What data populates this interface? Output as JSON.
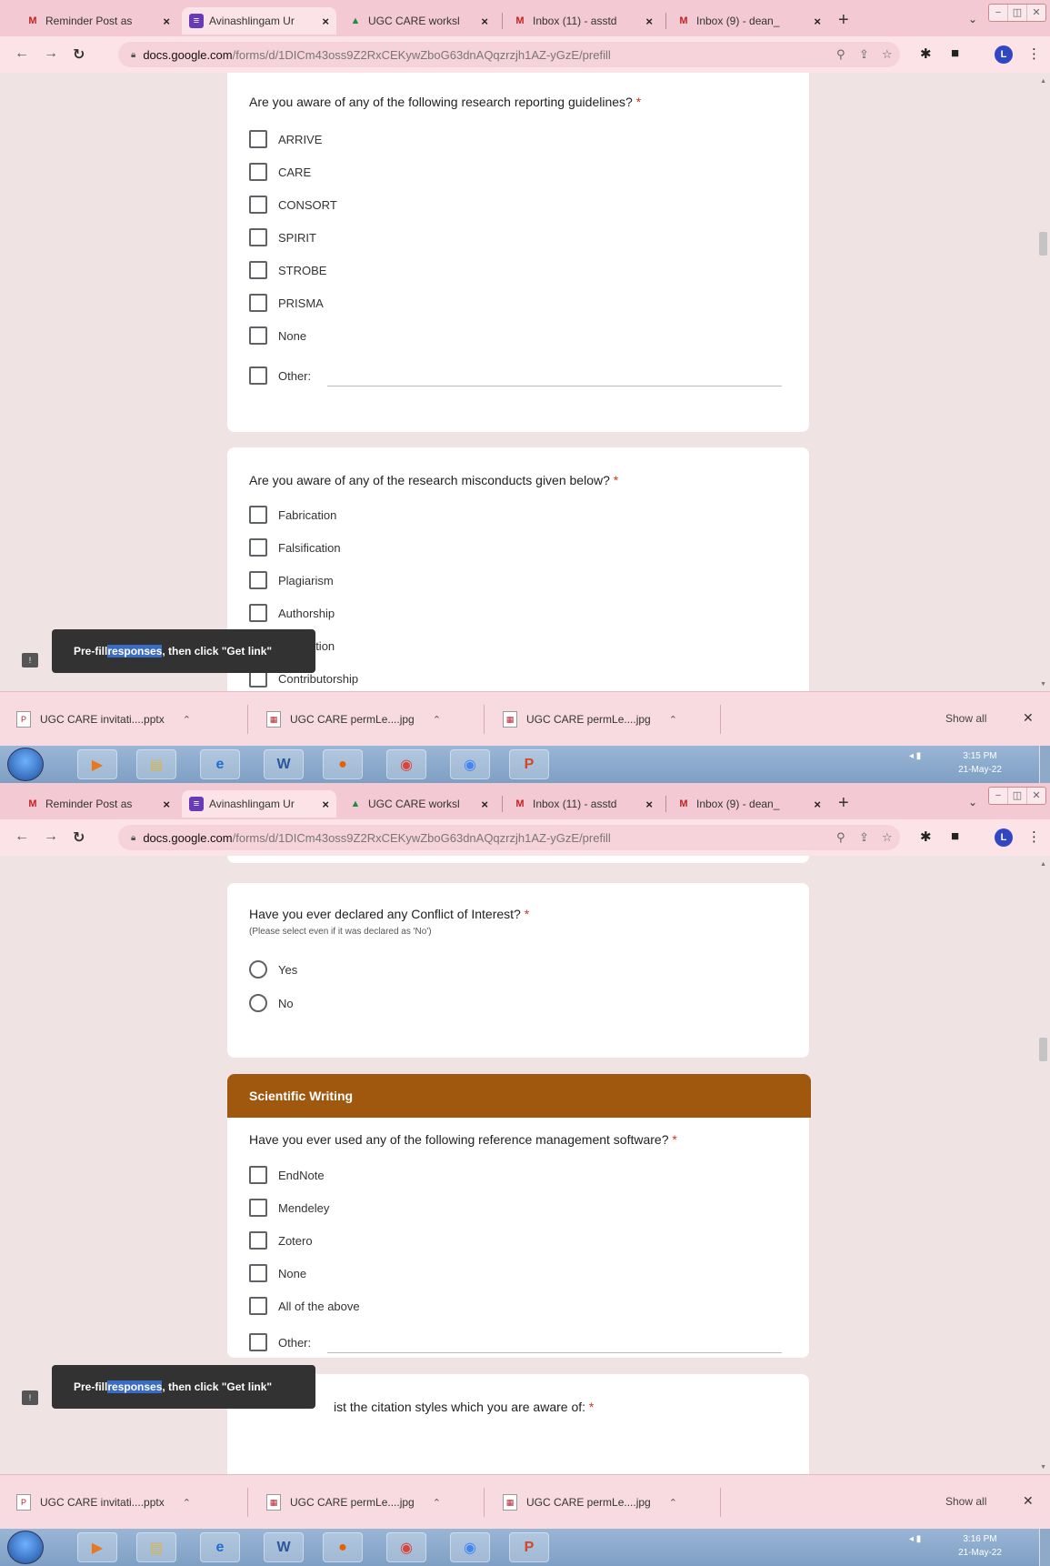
{
  "browser": {
    "tabs": [
      {
        "label": "Reminder Post as",
        "icon": "gmail-icon"
      },
      {
        "label": "Avinashlingam Ur",
        "icon": "forms-icon"
      },
      {
        "label": "UGC CARE worksl",
        "icon": "drive-icon"
      },
      {
        "label": "Inbox (11) - asstd",
        "icon": "gmail-icon"
      },
      {
        "label": "Inbox (9) - dean_",
        "icon": "gmail-icon"
      }
    ],
    "new_tab": "+",
    "url_domain": "docs.google.com",
    "url_path": "/forms/d/1DICm43oss9Z2RxCEKywZboG63dnAQqzrzjh1AZ-yGzE/prefill",
    "profile_initial": "L"
  },
  "screens": [
    {
      "cards": [
        {
          "question": "Are you aware of any of the following research reporting guidelines?",
          "options": [
            "ARRIVE",
            "CARE",
            "CONSORT",
            "SPIRIT",
            "STROBE",
            "PRISMA",
            "None"
          ],
          "other_label": "Other:"
        },
        {
          "question": "Are you aware of any of the research misconducts given below?",
          "options": [
            "Fabrication",
            "Falsification",
            "Plagiarism",
            "Authorship",
            "publication",
            "Contributorship"
          ]
        }
      ],
      "clock": {
        "time": "3:15 PM",
        "date": "21-May-22"
      }
    },
    {
      "cards": [
        {
          "question": "Have you ever declared any Conflict of Interest?",
          "help": "(Please select even if it was declared as 'No')",
          "options": [
            "Yes",
            "No"
          ]
        },
        {
          "section_title": "Scientific Writing",
          "question": "Have you ever used any of the following reference management software?",
          "options": [
            "EndNote",
            "Mendeley",
            "Zotero",
            "None",
            "All of the above"
          ],
          "other_label": "Other:"
        },
        {
          "question": "ist the citation styles which you are aware of:"
        }
      ],
      "clock": {
        "time": "3:16 PM",
        "date": "21-May-22"
      }
    }
  ],
  "required_mark": "*",
  "toast": {
    "pre": "Pre-fill ",
    "highlight": "responses",
    "post": ", then click \"Get link\""
  },
  "downloads": {
    "items": [
      "UGC CARE invitati....pptx",
      "UGC CARE permLe....jpg",
      "UGC CARE permLe....jpg"
    ],
    "show_all": "Show all"
  },
  "colors": {
    "section_header": "#a0580f",
    "tab_strip": "#f3c9d3",
    "required": "#d93025"
  }
}
